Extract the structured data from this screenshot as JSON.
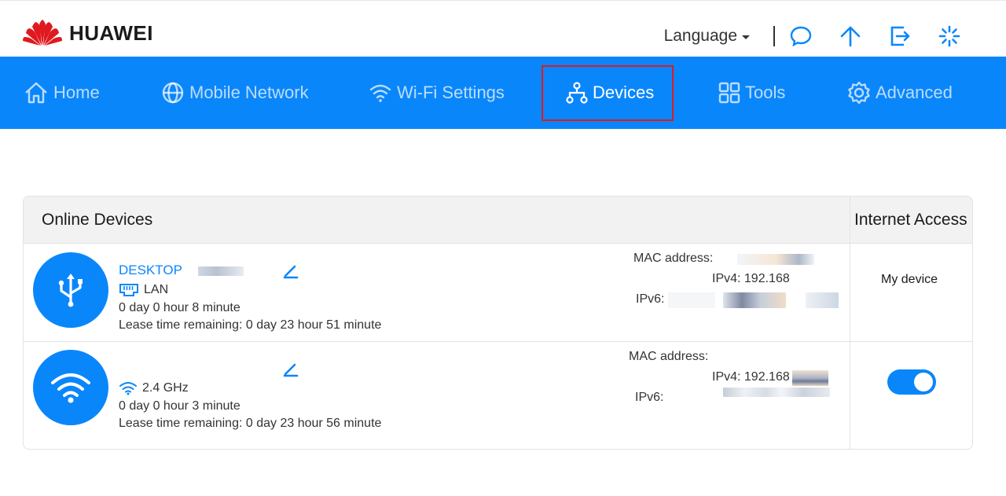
{
  "header": {
    "brand": "HUAWEI",
    "language_label": "Language",
    "icons": [
      "chat-icon",
      "upload-arrow-icon",
      "logout-icon",
      "loading-spinner-icon"
    ]
  },
  "nav": {
    "items": [
      {
        "label": "Home",
        "icon": "home-icon",
        "active": false
      },
      {
        "label": "Mobile Network",
        "icon": "globe-icon",
        "active": false
      },
      {
        "label": "Wi-Fi Settings",
        "icon": "wifi-icon",
        "active": false
      },
      {
        "label": "Devices",
        "icon": "network-tree-icon",
        "active": true
      },
      {
        "label": "Tools",
        "icon": "grid-icon",
        "active": false
      },
      {
        "label": "Advanced",
        "icon": "gear-icon",
        "active": false
      }
    ]
  },
  "devices": {
    "title": "Online Devices",
    "access_header": "Internet Access",
    "rows": [
      {
        "name": "DESKTOP",
        "type_icon": "usb-icon",
        "connection": "LAN",
        "connection_icon": "ethernet-icon",
        "online_time": "0 day 0 hour 8 minute",
        "lease": "Lease time remaining: 0 day 23 hour 51 minute",
        "mac_label": "MAC address:",
        "ipv4": "IPv4: 192.168",
        "ipv6_label": "IPv6:",
        "access": "My device"
      },
      {
        "name": "",
        "type_icon": "wifi-icon",
        "connection": "2.4 GHz",
        "connection_icon": "wifi-small-icon",
        "online_time": "0 day 0 hour 3 minute",
        "lease": "Lease time remaining: 0 day 23 hour 56 minute",
        "mac_label": "MAC address:",
        "ipv4": "IPv4: 192.168",
        "ipv6_label": "IPv6:",
        "access_enabled": true
      }
    ]
  },
  "colors": {
    "nav_bg": "#0a86fb",
    "brand_red": "#e0191f",
    "link_blue": "#0a86fb"
  }
}
